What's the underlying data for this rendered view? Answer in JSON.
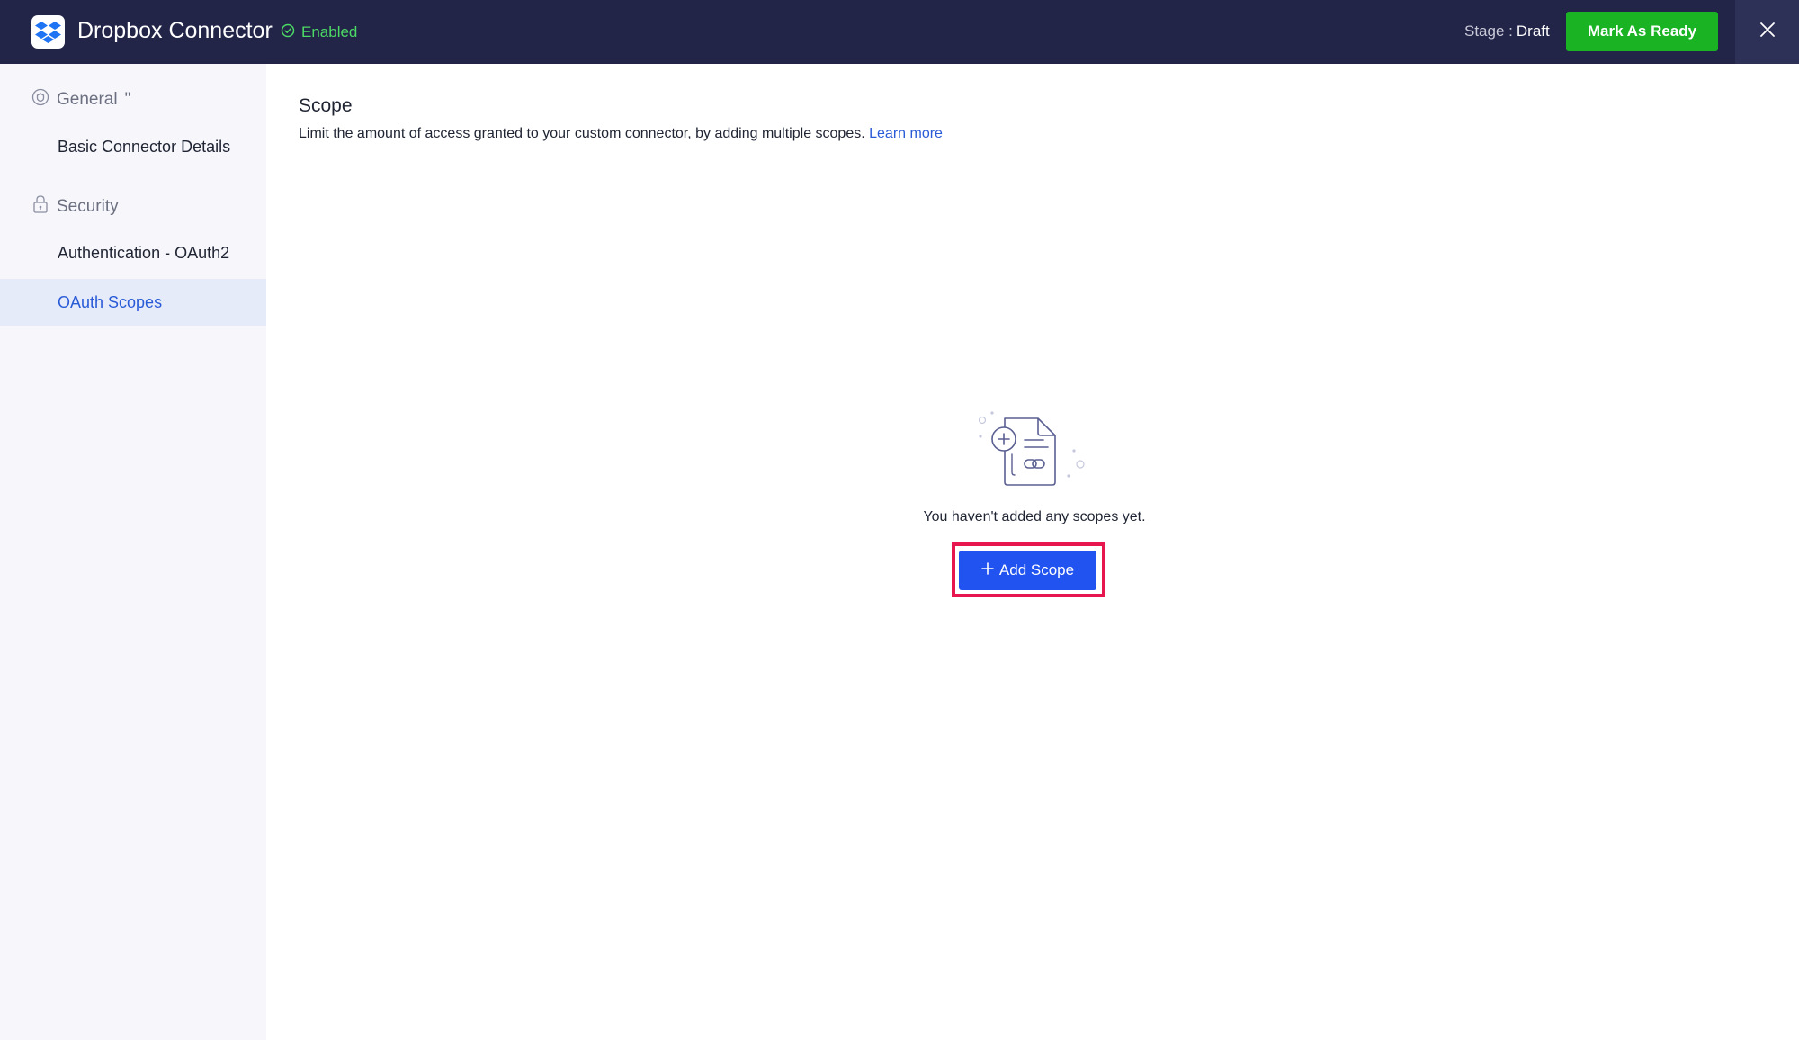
{
  "header": {
    "app_title": "Dropbox Connector",
    "status_label": "Enabled",
    "stage_label": "Stage :",
    "stage_value": "Draft",
    "ready_button_label": "Mark As Ready",
    "colors": {
      "background": "#222448",
      "status": "#4cd964",
      "ready_button": "#19b324"
    }
  },
  "sidebar": {
    "groups": [
      {
        "heading": "General",
        "icon": "general-icon",
        "items": [
          {
            "label": "Basic Connector Details",
            "active": false
          }
        ]
      },
      {
        "heading": "Security",
        "icon": "lock-icon",
        "items": [
          {
            "label": "Authentication - OAuth2",
            "active": false
          },
          {
            "label": "OAuth Scopes",
            "active": true
          }
        ]
      }
    ]
  },
  "main": {
    "title": "Scope",
    "description": "Limit the amount of access granted to your custom connector, by adding multiple scopes.",
    "learn_more_label": "Learn more",
    "empty_state": {
      "illustration": "document-link-add-icon",
      "message": "You haven't added any scopes yet.",
      "add_button_label": "Add Scope"
    },
    "colors": {
      "accent": "#2053ef",
      "link": "#2a5bd7",
      "highlight": "#e8164f"
    }
  }
}
